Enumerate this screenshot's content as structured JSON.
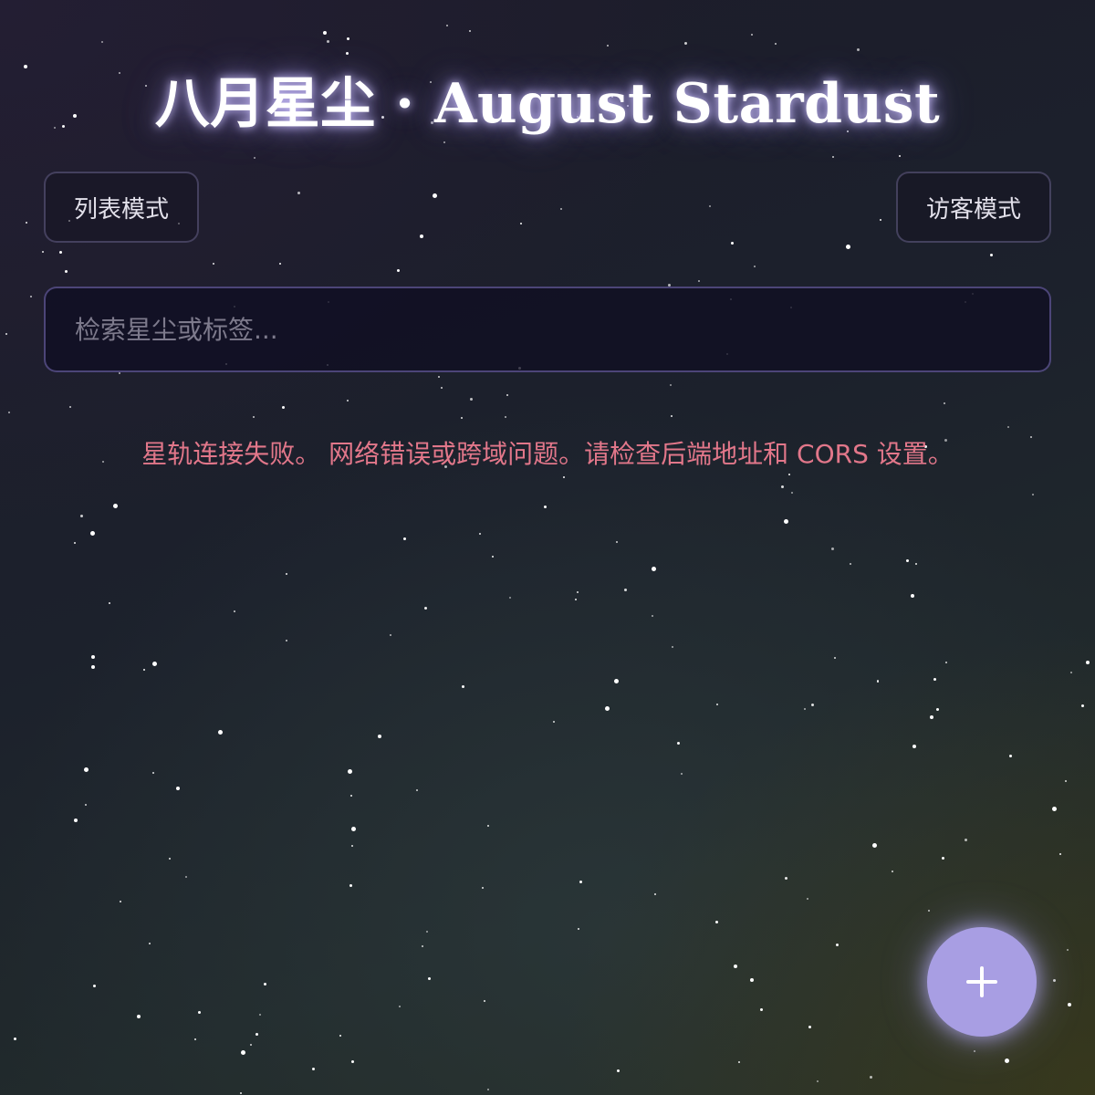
{
  "header": {
    "title": "八月星尘 · August Stardust"
  },
  "toolbar": {
    "list_mode_label": "列表模式",
    "guest_mode_label": "访客模式"
  },
  "search": {
    "value": "",
    "placeholder": "检索星尘或标签..."
  },
  "status": {
    "error_message": "星轨连接失败。 网络错误或跨域问题。请检查后端地址和 CORS 设置。"
  },
  "fab": {
    "icon": "plus-icon"
  },
  "colors": {
    "accent": "#a89ee3",
    "error": "#e2778a",
    "title_glow": "#cdc3ff"
  }
}
